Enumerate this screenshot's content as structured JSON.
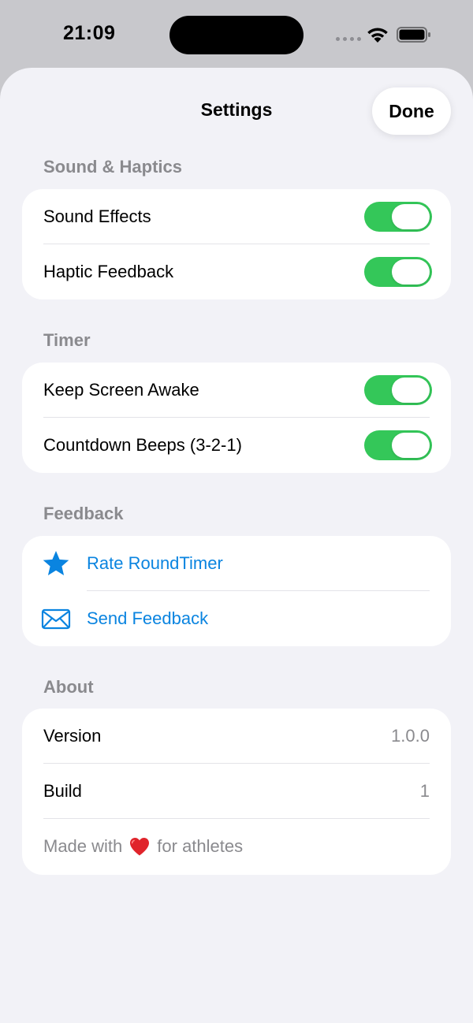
{
  "status_bar": {
    "time": "21:09"
  },
  "header": {
    "title": "Settings",
    "done_label": "Done"
  },
  "sections": {
    "sound_haptics": {
      "title": "Sound & Haptics",
      "rows": [
        {
          "label": "Sound Effects",
          "toggle_on": true
        },
        {
          "label": "Haptic Feedback",
          "toggle_on": true
        }
      ]
    },
    "timer": {
      "title": "Timer",
      "rows": [
        {
          "label": "Keep Screen Awake",
          "toggle_on": true
        },
        {
          "label": "Countdown Beeps (3-2-1)",
          "toggle_on": true
        }
      ]
    },
    "feedback": {
      "title": "Feedback",
      "rows": [
        {
          "label": "Rate RoundTimer",
          "icon": "star-icon"
        },
        {
          "label": "Send Feedback",
          "icon": "envelope-icon"
        }
      ]
    },
    "about": {
      "title": "About",
      "rows": [
        {
          "label": "Version",
          "value": "1.0.0"
        },
        {
          "label": "Build",
          "value": "1"
        }
      ],
      "footer_prefix": "Made with",
      "footer_icon": "heart-icon",
      "footer_suffix": "for athletes"
    }
  },
  "colors": {
    "accent_link": "#0a84e0",
    "toggle_on": "#34c759",
    "heart": "#e0242b",
    "sheet_background": "#f2f2f7"
  }
}
